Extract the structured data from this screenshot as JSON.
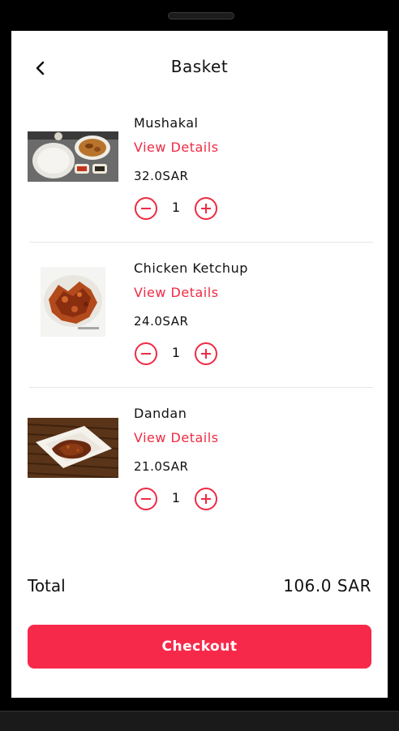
{
  "header": {
    "title": "Basket",
    "back_icon": "chevron-left-icon"
  },
  "items": [
    {
      "name": "Mushakal",
      "details_label": "View Details",
      "price": "32.0SAR",
      "quantity": "1",
      "image": "mushakal-platter-photo"
    },
    {
      "name": "Chicken Ketchup",
      "details_label": "View Details",
      "price": "24.0SAR",
      "quantity": "1",
      "image": "chicken-ketchup-photo"
    },
    {
      "name": "Dandan",
      "details_label": "View Details",
      "price": "21.0SAR",
      "quantity": "1",
      "image": "dandan-plate-photo"
    }
  ],
  "summary": {
    "total_label": "Total",
    "total_value": "106.0 SAR"
  },
  "checkout": {
    "label": "Checkout"
  },
  "colors": {
    "accent": "#ef2b44",
    "button": "#f7294a",
    "text": "#111111",
    "divider": "#e6e6e6"
  },
  "icons": {
    "decrement": "minus-circle-icon",
    "increment": "plus-circle-icon"
  }
}
